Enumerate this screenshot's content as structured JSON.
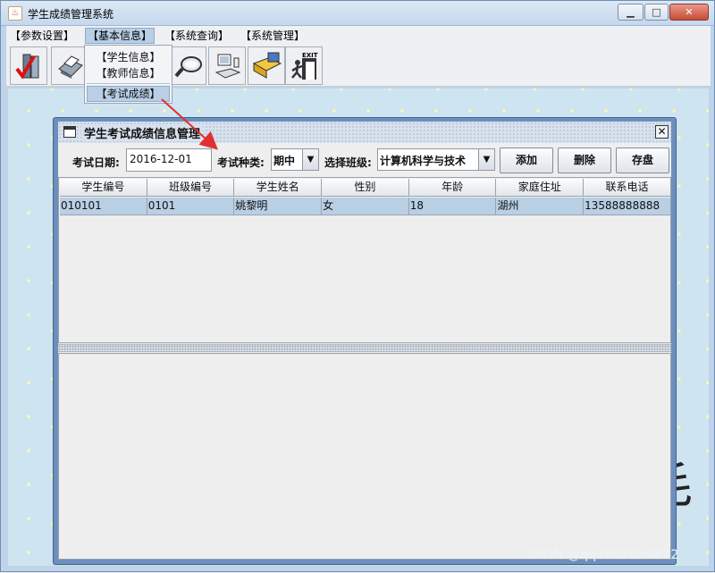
{
  "window": {
    "title": "学生成绩管理系统",
    "icon": "java-cup-icon",
    "controls": [
      "minimize-icon",
      "maximize-icon",
      "close-icon"
    ]
  },
  "menubar": {
    "items": [
      {
        "label": "【参数设置】"
      },
      {
        "label": "【基本信息】",
        "active": true
      },
      {
        "label": "【系统查询】"
      },
      {
        "label": "【系统管理】"
      }
    ]
  },
  "dropdown": {
    "items": [
      "【学生信息】",
      "【教师信息】",
      "【考试成绩】"
    ],
    "highlighted_index": 2
  },
  "toolbar": {
    "icons": [
      "checklist-icon",
      "printer-icon",
      "binder-icon",
      "address-card-icon",
      "search-lens-icon",
      "computer-user-icon",
      "folder-computer-icon",
      "exit-door-icon"
    ]
  },
  "frame": {
    "title": "学生考试成绩信息管理",
    "exam_date_label": "考试日期:",
    "exam_date_value": "2016-12-01",
    "exam_type_label": "考试种类:",
    "exam_type_value": "期中",
    "class_label": "选择班级:",
    "class_value": "计算机科学与技术",
    "buttons": {
      "add": "添加",
      "delete": "删除",
      "save": "存盘"
    }
  },
  "table": {
    "columns": [
      "学生编号",
      "班级编号",
      "学生姓名",
      "性别",
      "年龄",
      "家庭住址",
      "联系电话"
    ],
    "rows": [
      [
        "010101",
        "0101",
        "姚黎明",
        "女",
        "18",
        "湖州",
        "13588888888"
      ]
    ]
  },
  "background_glyph": "毛",
  "watermark": "CSDN @qq2892034822",
  "colors": {
    "menu_highlight": "#b8cfe6",
    "frame_border": "#6d8fbe",
    "selected_row": "#b8cfe4",
    "arrow": "#e03030"
  }
}
